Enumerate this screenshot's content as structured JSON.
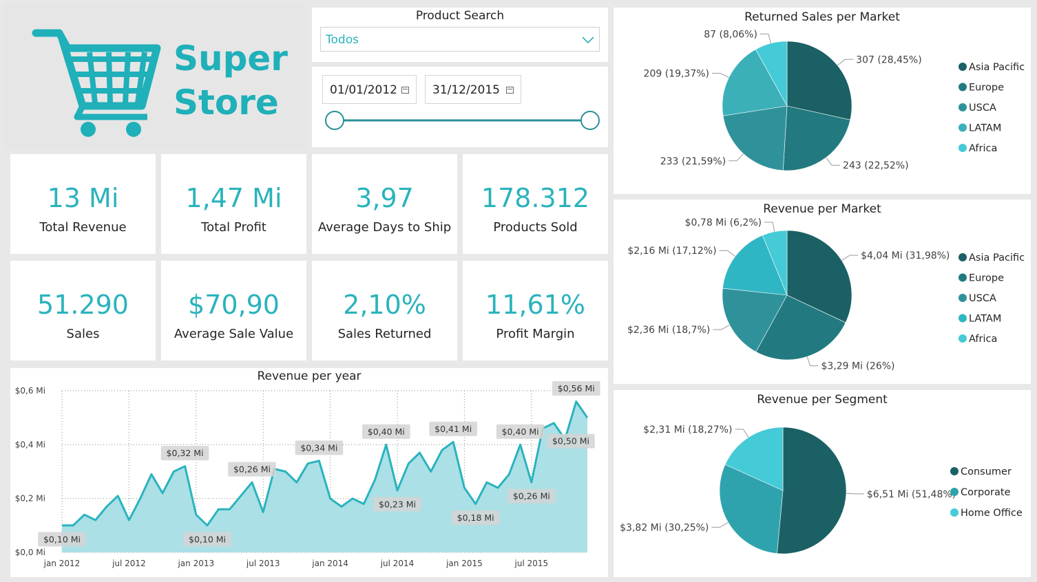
{
  "brand": {
    "line1": "Super",
    "line2": "Store",
    "color": "#1fb0b9",
    "icon": "shopping-cart-icon"
  },
  "product_search": {
    "title": "Product Search",
    "selected": "Todos"
  },
  "date_range": {
    "start": "01/01/2012",
    "end": "31/12/2015"
  },
  "kpis": [
    {
      "value": "13 Mi",
      "label": "Total Revenue"
    },
    {
      "value": "1,47 Mi",
      "label": "Total Profit"
    },
    {
      "value": "3,97",
      "label": "Average Days to Ship"
    },
    {
      "value": "178.312",
      "label": "Products Sold"
    },
    {
      "value": "51.290",
      "label": "Sales"
    },
    {
      "value": "$70,90",
      "label": "Average Sale Value"
    },
    {
      "value": "2,10%",
      "label": "Sales Returned"
    },
    {
      "value": "11,61%",
      "label": "Profit Margin"
    }
  ],
  "chart_data": [
    {
      "type": "area",
      "title": "Revenue per year",
      "ylim": [
        0,
        0.6
      ],
      "yticks": [
        0,
        0.2,
        0.4,
        0.6
      ],
      "ytick_labels": [
        "$0,0 Mi",
        "$0,2 Mi",
        "$0,4 Mi",
        "$0,6 Mi"
      ],
      "xtick_labels": [
        "jan 2012",
        "jul 2012",
        "jan 2013",
        "jul 2013",
        "jan 2014",
        "jul 2014",
        "jan 2015",
        "jul 2015"
      ],
      "grid": true,
      "color": "#2ab3bd",
      "values": [
        0.1,
        0.1,
        0.14,
        0.12,
        0.17,
        0.21,
        0.12,
        0.2,
        0.29,
        0.22,
        0.3,
        0.32,
        0.14,
        0.1,
        0.16,
        0.16,
        0.21,
        0.26,
        0.15,
        0.31,
        0.3,
        0.26,
        0.33,
        0.34,
        0.2,
        0.17,
        0.2,
        0.18,
        0.27,
        0.4,
        0.23,
        0.33,
        0.37,
        0.3,
        0.38,
        0.41,
        0.24,
        0.18,
        0.26,
        0.24,
        0.29,
        0.4,
        0.26,
        0.46,
        0.48,
        0.42,
        0.56,
        0.5
      ],
      "annotations": [
        {
          "index": 0,
          "label": "$0,10 Mi",
          "pos": "below"
        },
        {
          "index": 11,
          "label": "$0,32 Mi",
          "pos": "above"
        },
        {
          "index": 13,
          "label": "$0,10 Mi",
          "pos": "below"
        },
        {
          "index": 17,
          "label": "$0,26 Mi",
          "pos": "above"
        },
        {
          "index": 23,
          "label": "$0,34 Mi",
          "pos": "above"
        },
        {
          "index": 29,
          "label": "$0,40 Mi",
          "pos": "above"
        },
        {
          "index": 30,
          "label": "$0,23 Mi",
          "pos": "below"
        },
        {
          "index": 35,
          "label": "$0,41 Mi",
          "pos": "above"
        },
        {
          "index": 37,
          "label": "$0,18 Mi",
          "pos": "below"
        },
        {
          "index": 41,
          "label": "$0,40 Mi",
          "pos": "above"
        },
        {
          "index": 42,
          "label": "$0,26 Mi",
          "pos": "below"
        },
        {
          "index": 46,
          "label": "$0,56 Mi",
          "pos": "above"
        },
        {
          "index": 47,
          "label": "$0,50 Mi",
          "pos": "left"
        }
      ]
    },
    {
      "type": "pie",
      "title": "Returned Sales per Market",
      "slices": [
        {
          "name": "Asia Pacific",
          "value": 307,
          "label": "307 (28,45%)",
          "color": "#1b6064"
        },
        {
          "name": "Europe",
          "value": 243,
          "label": "243 (22,52%)",
          "color": "#227a80"
        },
        {
          "name": "USCA",
          "value": 233,
          "label": "233 (21,59%)",
          "color": "#2f929b"
        },
        {
          "name": "LATAM",
          "value": 209,
          "label": "209 (19,37%)",
          "color": "#3bb0b9"
        },
        {
          "name": "Africa",
          "value": 87,
          "label": "87 (8,06%)",
          "color": "#45cad7"
        }
      ],
      "legend": "right"
    },
    {
      "type": "pie",
      "title": "Revenue per Market",
      "slices": [
        {
          "name": "Asia Pacific",
          "value": 31.98,
          "label": "$4,04 Mi (31,98%)",
          "color": "#1b6064"
        },
        {
          "name": "Europe",
          "value": 26,
          "label": "$3,29 Mi (26%)",
          "color": "#227a80"
        },
        {
          "name": "USCA",
          "value": 18.7,
          "label": "$2,36 Mi (18,7%)",
          "color": "#2f929b"
        },
        {
          "name": "LATAM",
          "value": 17.12,
          "label": "$2,16 Mi (17,12%)",
          "color": "#2fb6c4"
        },
        {
          "name": "Africa",
          "value": 6.2,
          "label": "$0,78 Mi (6,2%)",
          "color": "#45cad7"
        }
      ],
      "legend": "right"
    },
    {
      "type": "pie",
      "title": "Revenue per Segment",
      "slices": [
        {
          "name": "Consumer",
          "value": 51.48,
          "label": "$6,51 Mi (51,48%)",
          "color": "#1b6064"
        },
        {
          "name": "Corporate",
          "value": 30.25,
          "label": "$3,82 Mi (30,25%)",
          "color": "#2fa3ad"
        },
        {
          "name": "Home Office",
          "value": 18.27,
          "label": "$2,31 Mi (18,27%)",
          "color": "#45cad7"
        }
      ],
      "legend": "right"
    }
  ]
}
